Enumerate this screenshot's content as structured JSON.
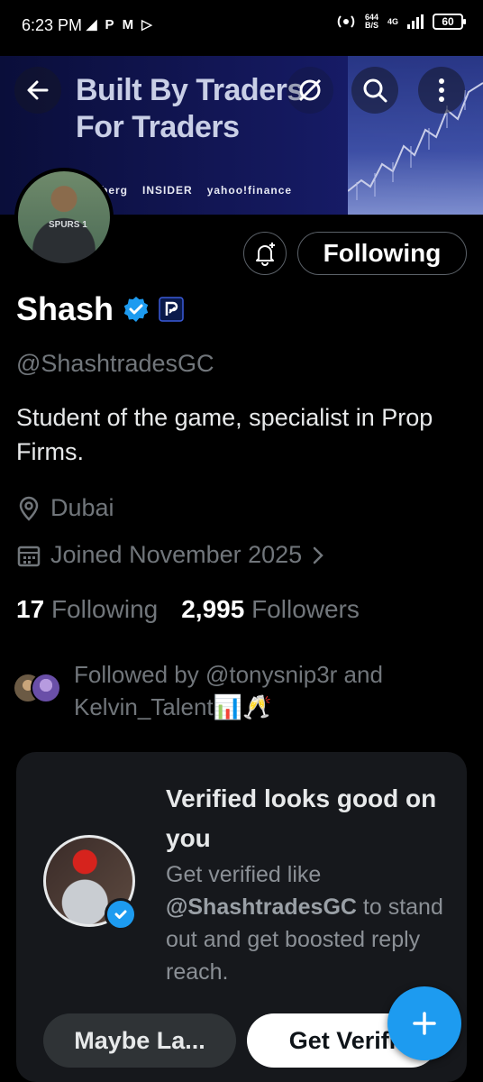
{
  "status_bar": {
    "time": "6:23 PM",
    "left_icons": [
      "telegram-icon",
      "paypal-icon",
      "gmail-icon",
      "play-icon"
    ],
    "network_speed": "644",
    "network_unit": "B/S",
    "network_type": "4G",
    "battery": "60"
  },
  "banner": {
    "line1": "Built By Traders",
    "line2": "For Traders",
    "logos": [
      "berg",
      "INSIDER",
      "yahoo!finance"
    ]
  },
  "profile": {
    "name": "Shash",
    "handle": "@ShashtradesGC",
    "bio": "Student of the game, specialist in Prop Firms.",
    "location": "Dubai",
    "joined": "Joined November 2025",
    "following_count": "17",
    "following_label": "Following",
    "followers_count": "2,995",
    "followers_label": "Followers",
    "followed_by": "Followed by @tonysnip3r and Kelvin_Talent📊🥂",
    "avatar_jersey": "SPURS 1"
  },
  "actions": {
    "following_button": "Following"
  },
  "verified_card": {
    "title": "Verified looks good on you",
    "desc_prefix": "Get verified like",
    "desc_handle": "@ShashtradesGC",
    "desc_suffix": "to stand out and get boosted reply reach.",
    "maybe_later": "Maybe La...",
    "get_verified": "Get Verifi"
  },
  "colors": {
    "accent": "#1d9bf0",
    "background": "#000000",
    "muted_text": "#71767b"
  }
}
